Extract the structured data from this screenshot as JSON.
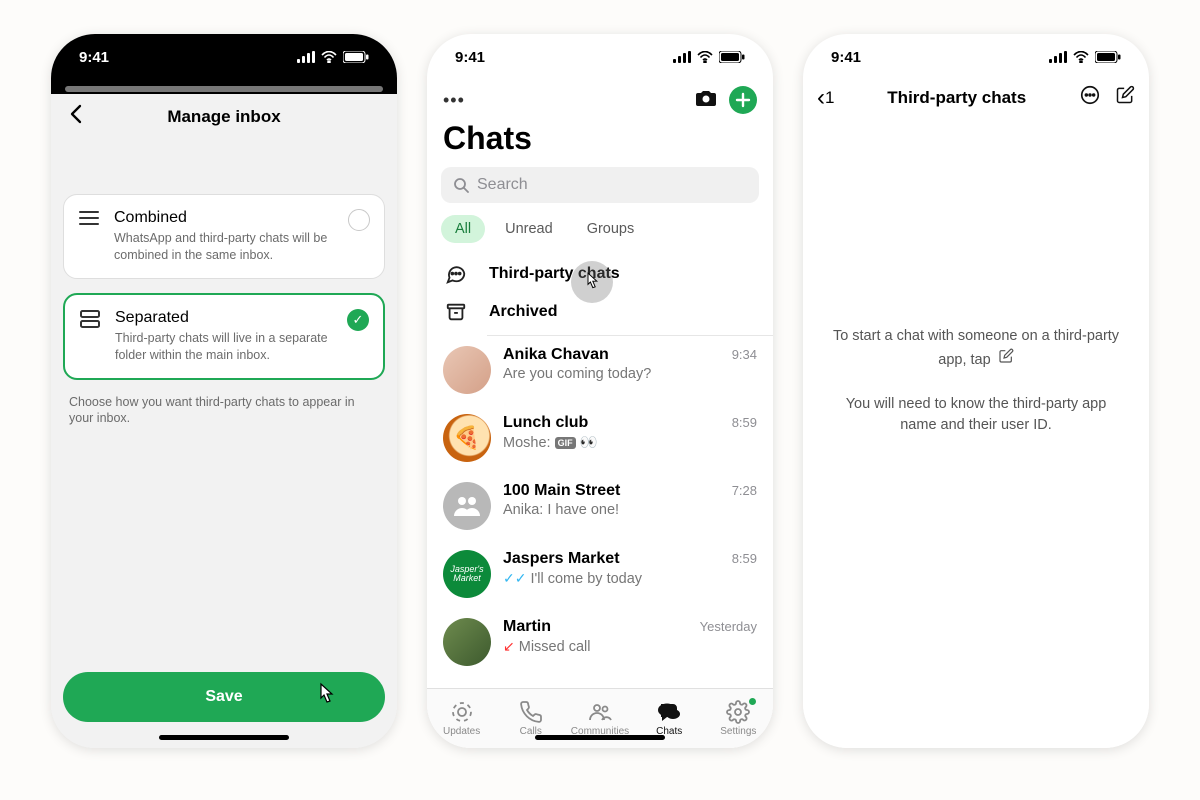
{
  "status": {
    "time": "9:41"
  },
  "s1": {
    "title": "Manage inbox",
    "combined": {
      "title": "Combined",
      "desc": "WhatsApp and third-party chats will be combined in the same inbox."
    },
    "separated": {
      "title": "Separated",
      "desc": "Third-party chats will live in a separate folder within the main inbox."
    },
    "hint": "Choose how you want third-party chats to appear in your inbox.",
    "save": "Save"
  },
  "s2": {
    "title": "Chats",
    "search_ph": "Search",
    "filters": {
      "all": "All",
      "unread": "Unread",
      "groups": "Groups"
    },
    "pinned": {
      "third": "Third-party chats",
      "arch": "Archived"
    },
    "chats": [
      {
        "name": "Anika Chavan",
        "preview": "Are you coming today?",
        "time": "9:34",
        "kind": "plain"
      },
      {
        "name": "Lunch club",
        "preview": "Moshe:",
        "time": "8:59",
        "kind": "gif"
      },
      {
        "name": "100 Main Street",
        "preview": "Anika: I have one!",
        "time": "7:28",
        "kind": "plain"
      },
      {
        "name": "Jaspers Market",
        "preview": "I'll come by today",
        "time": "8:59",
        "kind": "read"
      },
      {
        "name": "Martin",
        "preview": "Missed call",
        "time": "Yesterday",
        "kind": "missed"
      }
    ],
    "tabs": {
      "u": "Updates",
      "c": "Calls",
      "m": "Communities",
      "h": "Chats",
      "s": "Settings"
    }
  },
  "s3": {
    "back_count": "1",
    "title": "Third-party chats",
    "p1": "To start a chat with someone on a third-party app, tap",
    "p2": "You will need to know the third-party app name and their user ID."
  }
}
